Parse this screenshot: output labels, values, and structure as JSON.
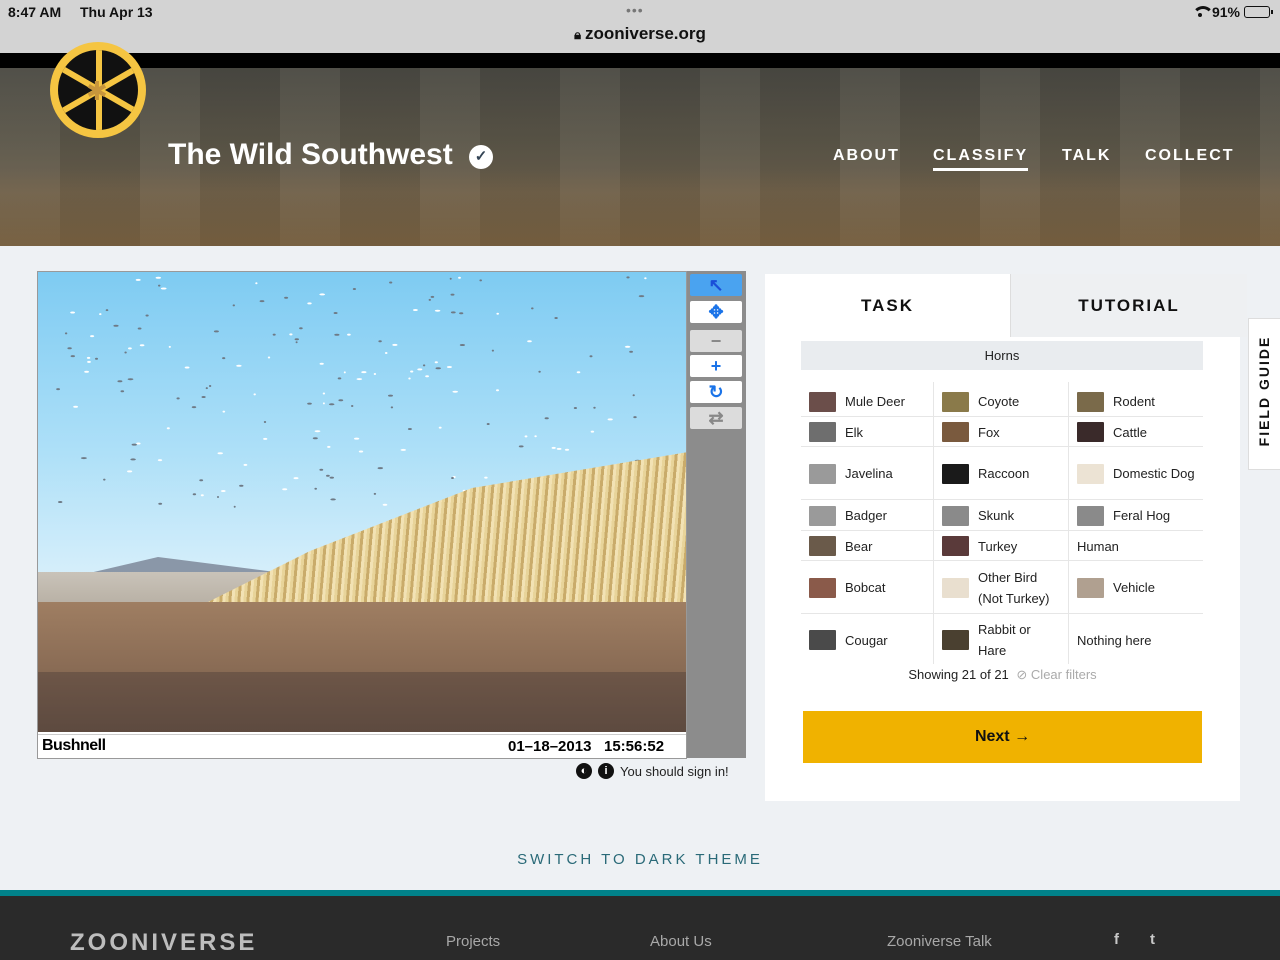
{
  "status_bar": {
    "time": "8:47 AM",
    "date": "Thu Apr 13",
    "battery": "91%",
    "battery_level": 0.91,
    "url": "zooniverse.org"
  },
  "project": {
    "title": "The Wild Southwest"
  },
  "nav": {
    "about": "ABOUT",
    "classify": "CLASSIFY",
    "talk": "TALK",
    "collect": "COLLECT"
  },
  "subject": {
    "camera_brand": "Bushnell",
    "date": "01–18–2013",
    "time": "15:56:52"
  },
  "viewer": {
    "sign_in_text": "You should sign in!"
  },
  "task_panel": {
    "tabs": {
      "task": "TASK",
      "tutorial": "TUTORIAL"
    },
    "filter_label": "Horns",
    "choices": [
      {
        "label": "Mule Deer",
        "color": "#6b4e4a"
      },
      {
        "label": "Coyote",
        "color": "#8a7a4a"
      },
      {
        "label": "Rodent",
        "color": "#7a6a4a"
      },
      {
        "label": "Elk",
        "color": "#6e6e6e"
      },
      {
        "label": "Fox",
        "color": "#7a5a3e"
      },
      {
        "label": "Cattle",
        "color": "#3a2a2a"
      },
      {
        "label": "Javelina",
        "color": "#9a9a9a"
      },
      {
        "label": "Raccoon",
        "color": "#1a1a1a"
      },
      {
        "label": "Domestic Dog",
        "color": "#ece3d4"
      },
      {
        "label": "Badger",
        "color": "#9a9a9a"
      },
      {
        "label": "Skunk",
        "color": "#8a8a8a"
      },
      {
        "label": "Feral Hog",
        "color": "#8a8a8a"
      },
      {
        "label": "Bear",
        "color": "#6a5a4a"
      },
      {
        "label": "Turkey",
        "color": "#5a3a3a"
      },
      {
        "label": "Human",
        "color": ""
      },
      {
        "label": "Bobcat",
        "color": "#8a5a4a"
      },
      {
        "label": "Other Bird (Not Turkey)",
        "color": "#e9dfcf"
      },
      {
        "label": "Vehicle",
        "color": "#b0a090"
      },
      {
        "label": "Cougar",
        "color": "#4a4a4a"
      },
      {
        "label": "Rabbit or Hare",
        "color": "#4a4030"
      },
      {
        "label": "Nothing here",
        "color": ""
      }
    ],
    "showing": "Showing 21 of 21",
    "clear_filters": "Clear filters",
    "next_label": "Next →"
  },
  "field_guide": "FIELD GUIDE",
  "theme_switch": "SWITCH TO DARK THEME",
  "footer": {
    "logo": "ZOONIVERSE",
    "links": [
      "Projects",
      "About Us",
      "Zooniverse Talk"
    ],
    "social": [
      "f",
      "t"
    ]
  },
  "colors": {
    "accent": "#f0b200",
    "teal": "#00828a"
  }
}
